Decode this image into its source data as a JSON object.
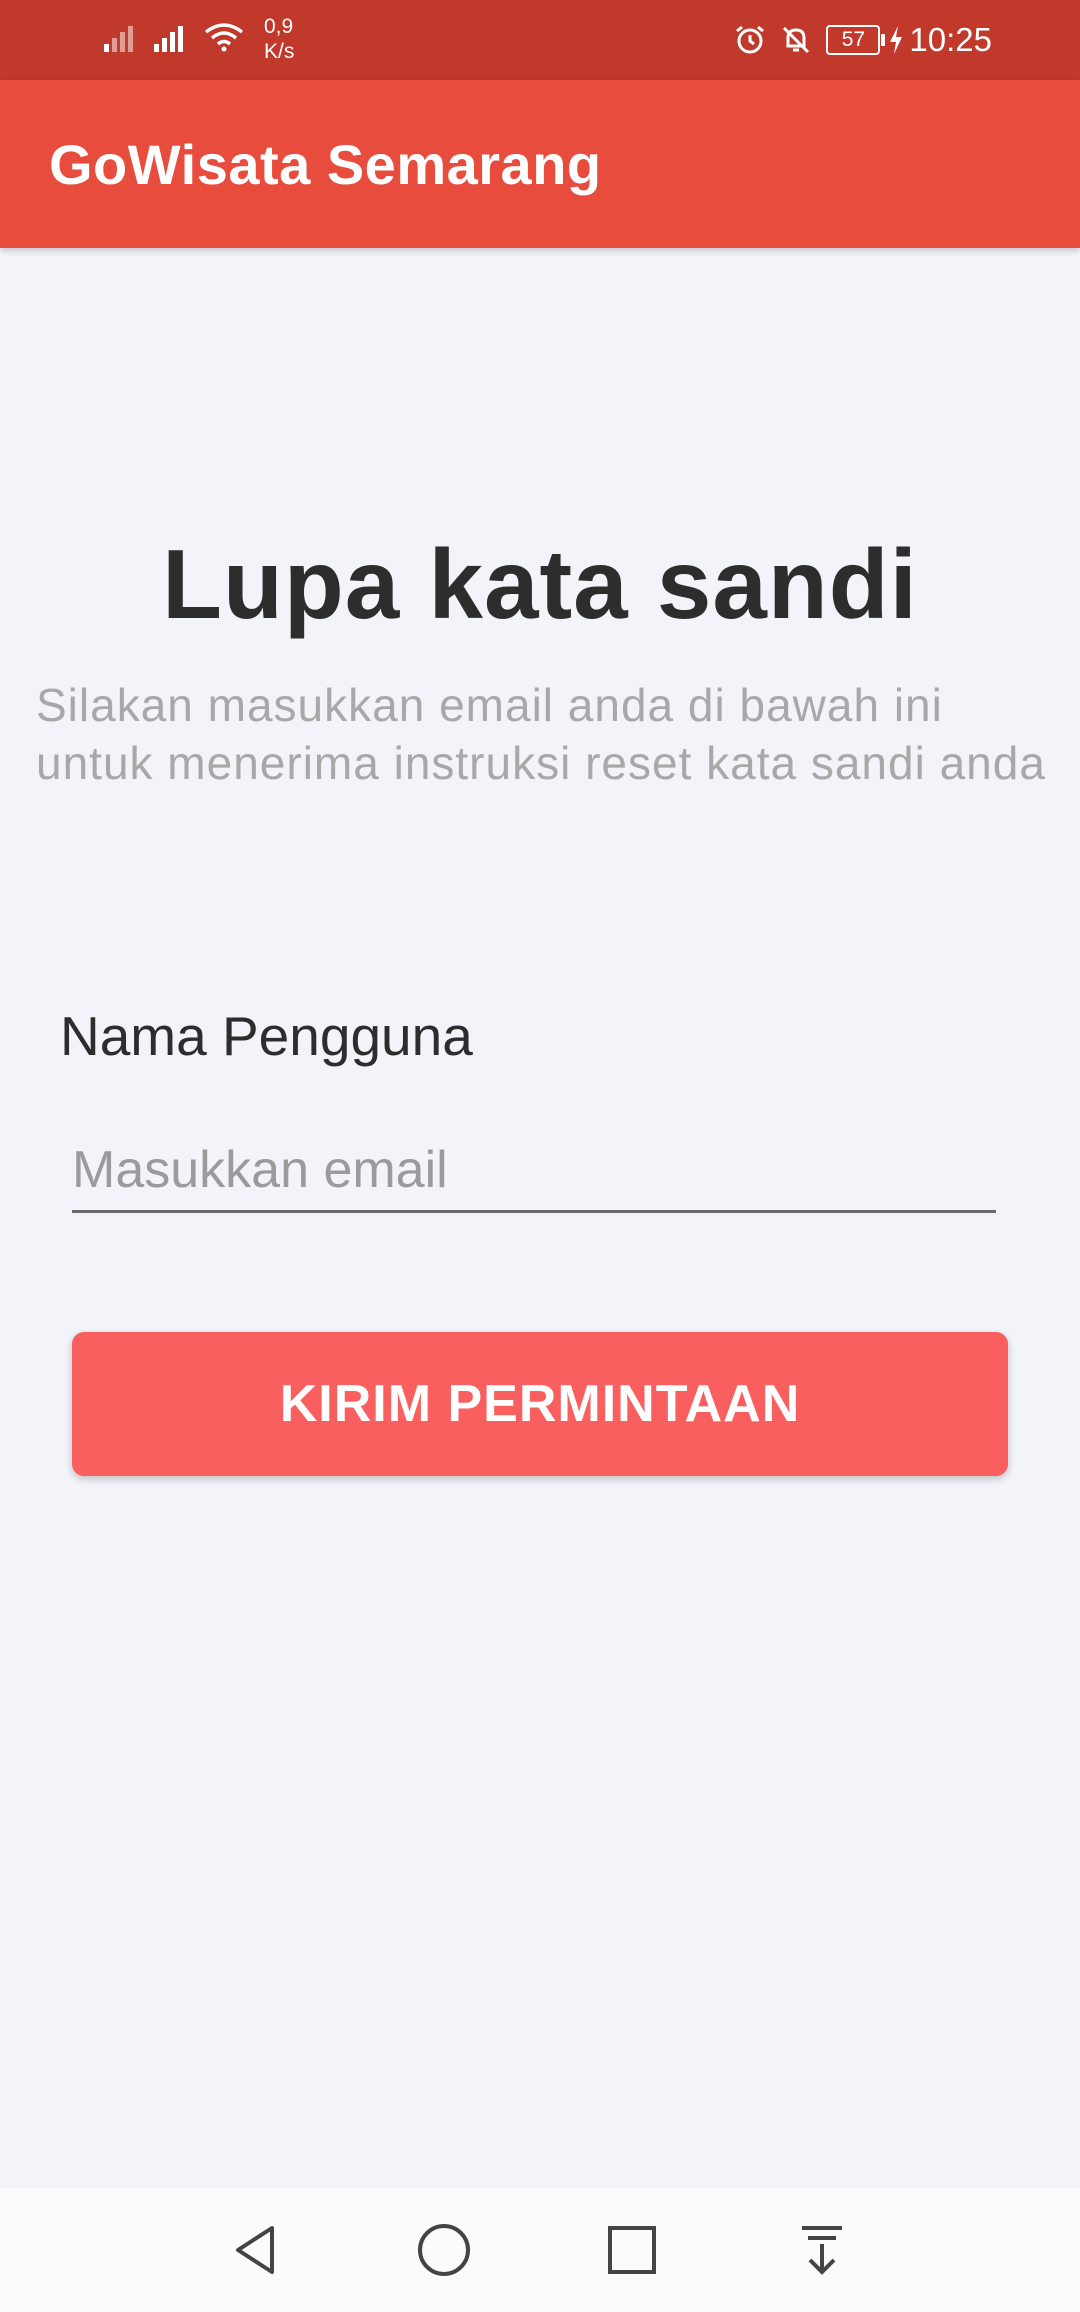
{
  "status_bar": {
    "net_speed_value": "0,9",
    "net_speed_unit": "K/s",
    "battery": "57",
    "time": "10:25",
    "icons": [
      "signal-weak-icon",
      "signal-icon",
      "wifi-icon",
      "alarm-icon",
      "bell-off-icon",
      "battery-icon",
      "charging-icon"
    ]
  },
  "app_bar": {
    "title": "GoWisata Semarang",
    "color": "#e74c3c"
  },
  "main": {
    "title": "Lupa kata sandi",
    "subtitle": "Silakan masukkan email anda di bawah ini untuk menerima instruksi reset kata sandi anda",
    "field_label": "Nama Pengguna",
    "email_placeholder": "Masukkan email",
    "submit_label": "KIRIM PERMINTAAN",
    "button_color": "#fa5f60"
  },
  "nav_bar": {
    "icons": [
      "back-icon",
      "home-icon",
      "recents-icon",
      "notification-pull-icon"
    ]
  }
}
